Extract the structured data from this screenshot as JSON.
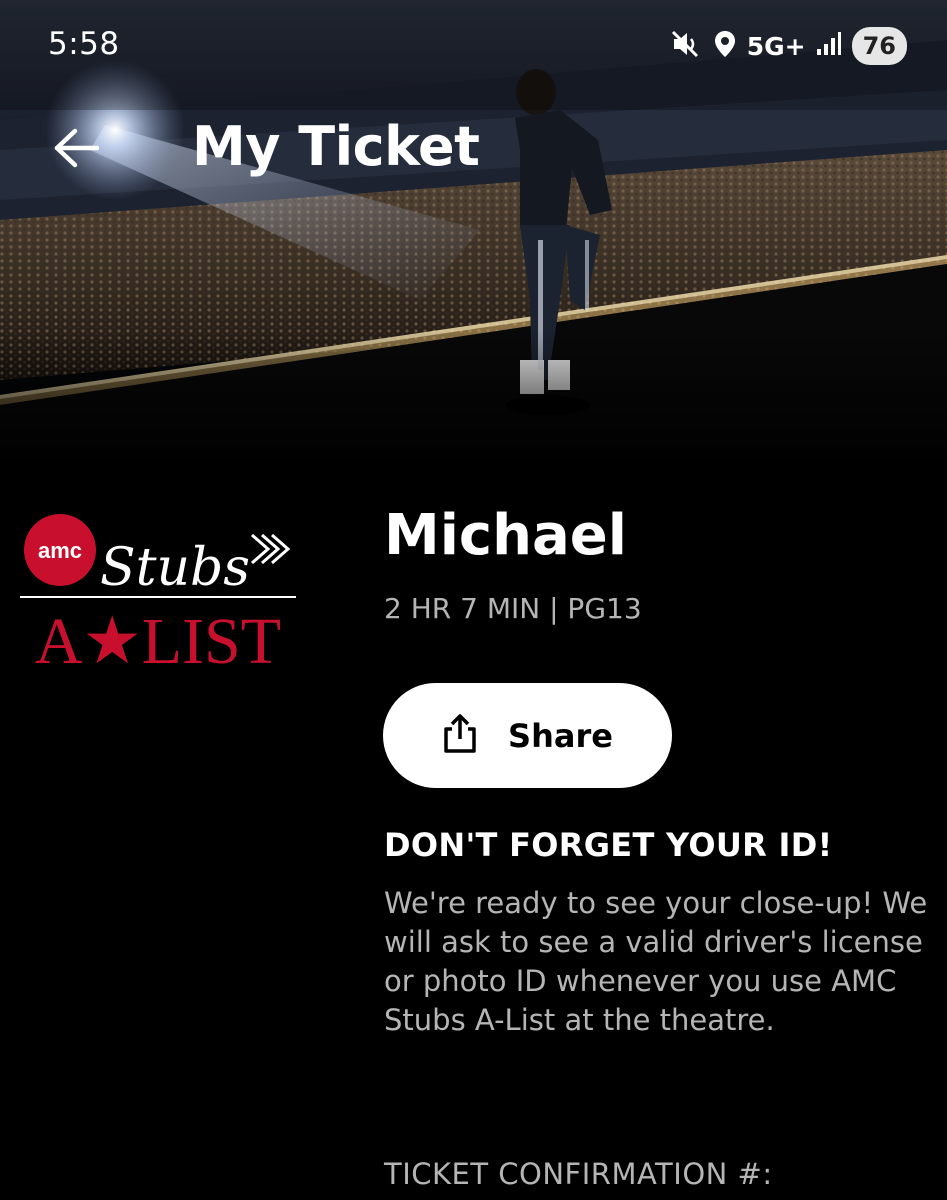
{
  "status_bar": {
    "time": "5:58",
    "network": "5G+",
    "battery": "76",
    "icons": [
      "mute-icon",
      "location-icon",
      "signal-icon"
    ]
  },
  "header": {
    "back_icon": "back-arrow-icon",
    "title": "My Ticket"
  },
  "hero": {
    "image": "concert-performer-photo"
  },
  "logo": {
    "brand": "AMC Stubs A-List",
    "badge_text": "amc",
    "script_text": "Stubs",
    "tier_text": "A★LIST"
  },
  "movie": {
    "title": "Michael",
    "meta": "2 HR 7 MIN | PG13"
  },
  "share": {
    "icon": "share-icon",
    "label": "Share"
  },
  "id_notice": {
    "heading": "DON'T FORGET YOUR ID!",
    "body": "We're ready to see your close-up! We will ask to see a valid driver's license or photo ID whenever you use AMC Stubs A-List at the theatre."
  },
  "confirmation": {
    "label": "TICKET CONFIRMATION #:"
  },
  "colors": {
    "background": "#000000",
    "accent_red": "#c8102e",
    "secondary_text": "#b5b5b5",
    "button_bg": "#ffffff"
  }
}
